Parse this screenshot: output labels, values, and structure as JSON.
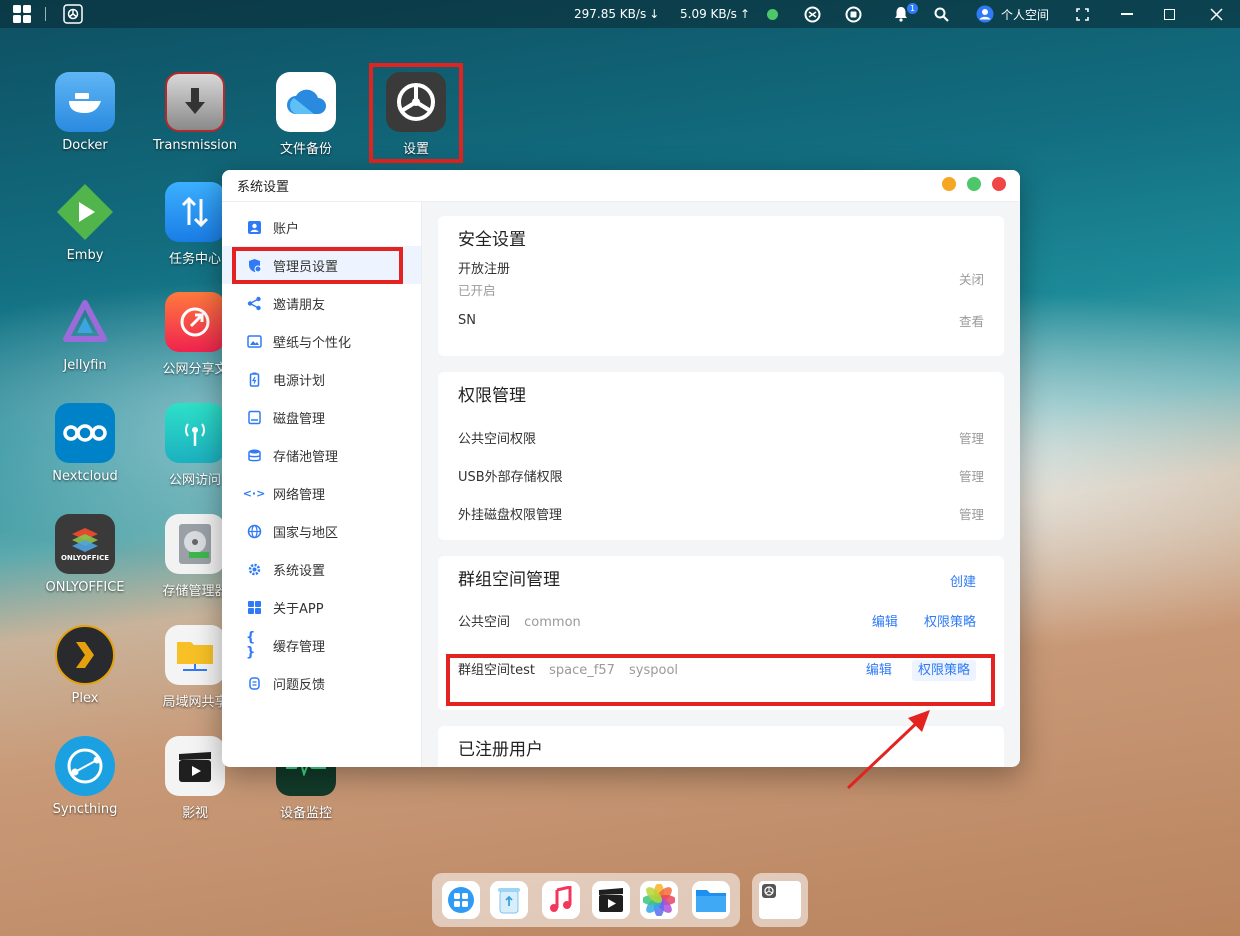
{
  "topbar": {
    "download_speed": "297.85 KB/s",
    "upload_speed": "5.09 KB/s",
    "notification_count": "1",
    "user_space": "个人空间"
  },
  "desktop": {
    "apps": [
      {
        "label": "Docker"
      },
      {
        "label": "Transmission"
      },
      {
        "label": "文件备份"
      },
      {
        "label": "设置"
      },
      {
        "label": "Emby"
      },
      {
        "label": "任务中心"
      },
      {
        "label": "Jellyfin"
      },
      {
        "label": "公网分享文"
      },
      {
        "label": "Nextcloud"
      },
      {
        "label": "公网访问"
      },
      {
        "label": "ONLYOFFICE"
      },
      {
        "label": "存储管理器"
      },
      {
        "label": "Plex"
      },
      {
        "label": "局域网共享"
      },
      {
        "label": "Syncthing"
      },
      {
        "label": "影视"
      },
      {
        "label": "设备监控"
      }
    ],
    "onlyoffice_logo_text": "ONLYOFFICE"
  },
  "window": {
    "title": "系统设置",
    "sidebar": [
      {
        "label": "账户",
        "icon": "account-icon"
      },
      {
        "label": "管理员设置",
        "icon": "admin-shield-icon"
      },
      {
        "label": "邀请朋友",
        "icon": "share-icon"
      },
      {
        "label": "壁纸与个性化",
        "icon": "wallpaper-icon"
      },
      {
        "label": "电源计划",
        "icon": "battery-icon"
      },
      {
        "label": "磁盘管理",
        "icon": "disk-icon"
      },
      {
        "label": "存储池管理",
        "icon": "database-icon"
      },
      {
        "label": "网络管理",
        "icon": "network-icon"
      },
      {
        "label": "国家与地区",
        "icon": "globe-icon"
      },
      {
        "label": "系统设置",
        "icon": "gear-icon"
      },
      {
        "label": "关于APP",
        "icon": "grid-icon"
      },
      {
        "label": "缓存管理",
        "icon": "braces-icon"
      },
      {
        "label": "问题反馈",
        "icon": "feedback-icon"
      }
    ],
    "security": {
      "title": "安全设置",
      "open_register": "开放注册",
      "open_register_status": "已开启",
      "open_register_action": "关闭",
      "sn": "SN",
      "sn_action": "查看"
    },
    "permissions": {
      "title": "权限管理",
      "rows": [
        {
          "label": "公共空间权限",
          "action": "管理"
        },
        {
          "label": "USB外部存储权限",
          "action": "管理"
        },
        {
          "label": "外挂磁盘权限管理",
          "action": "管理"
        }
      ]
    },
    "group_space": {
      "title": "群组空间管理",
      "create": "创建",
      "rows": [
        {
          "name": "公共空间",
          "id": "common",
          "pool": "",
          "edit": "编辑",
          "policy": "权限策略"
        },
        {
          "name": "群组空间test",
          "id": "space_f57",
          "pool": "syspool",
          "edit": "编辑",
          "policy": "权限策略"
        }
      ]
    },
    "registered_users": {
      "title": "已注册用户"
    }
  },
  "colors": {
    "accent": "#2f7bf6",
    "annotation": "#e3231f"
  }
}
